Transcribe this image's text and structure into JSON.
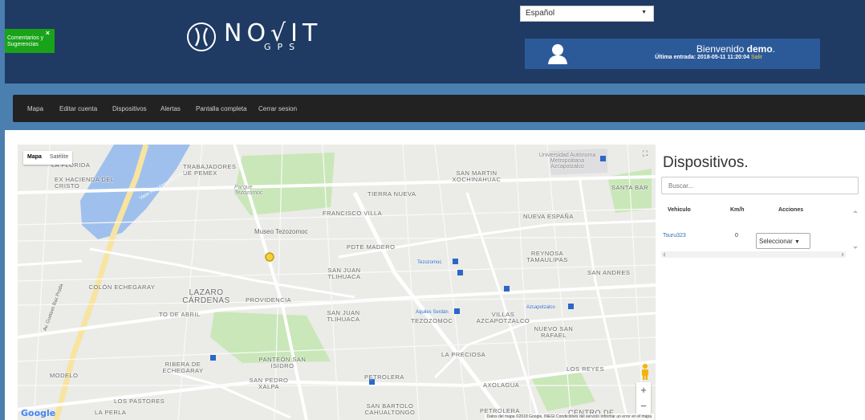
{
  "feedback": {
    "label": "Comentarios y Sugerencias",
    "close": "×"
  },
  "logo": {
    "brand": "NO√IT",
    "sub": "GPS"
  },
  "language": {
    "selected": "Español"
  },
  "welcome": {
    "greeting": "Bienvenido",
    "user": "demo",
    "period": ".",
    "last_login_label": "Última entrada: 2018-05-11 11:20:04",
    "logout": "Salir"
  },
  "nav": {
    "items": [
      "Mapa",
      "Editar cuenta",
      "Dispositivos",
      "Alertas",
      "Pantalla completa",
      "Cerrar sesion"
    ]
  },
  "map": {
    "type_map": "Mapa",
    "type_satellite": "Satélite",
    "zoom_in": "+",
    "zoom_out": "−",
    "attribution": "Datos del mapa ©2018 Google, INEGI   Condiciones del servicio   Informar un error en el mapa",
    "google": "Google",
    "labels": {
      "florida": "LA FLORIDA",
      "hacienda": "EX HACIENDA DEL CRISTO",
      "trabajadores": "TRABAJADORES DE PEMEX",
      "sanmartin": "SAN MARTIN XOCHINAHUAC",
      "universidad": "Universidad Autónoma Metropolitana Azcapotzalco",
      "santabar": "SANTA BAR",
      "parque": "Parque Tezozomoc",
      "tierranueva": "TIERRA NUEVA",
      "franciscovilla": "FRANCISCO VILLA",
      "nuevaespana": "NUEVA ESPAÑA",
      "museo": "Museo Tezozomoc",
      "pdte": "PDTE MADERO",
      "reynosa": "REYNOSA TAMAULIPAS",
      "sanjuan1": "SAN JUAN TLIHUACA",
      "sanandres": "SAN ANDRES",
      "colon": "COLÓN ECHEGARAY",
      "lazaro": "LAZARO CÁRDENAS",
      "providencia": "PROVIDENCIA",
      "deabril": "TO DE ABRIL",
      "sanjuan2": "SAN JUAN TLIHUACA",
      "tezozomoc": "TEZOZOMOC",
      "villas": "VILLAS AZCAPOTZALCO",
      "nuevo": "NUEVO SAN RAFAEL",
      "lapreciosa": "LA PRECIOSA",
      "panteon": "PANTEÓN SAN ISIDRO",
      "riberas": "RIBERA DE ECHEGARAY",
      "losreyes": "LOS REYES",
      "modelo": "MODELO",
      "sanpedro": "SAN PEDRO XALPA",
      "petrolera": "PETROLERA",
      "axolagua": "AXOLAGUA",
      "lospastores": "LOS PASTORES",
      "laperla": "LA PERLA",
      "sanbartolo": "SAN BARTOLO CAHUALTONGO",
      "petrolera2": "PETROLERA",
      "centrode": "CENTRO DE",
      "canal": "Vaso Regulador El Cristo",
      "gbaz": "Av. Gustavo Baz Prada",
      "tezozomocm": "Tezozomoc",
      "aquiles": "Aquiles Serdán",
      "azcapotzalcom": "Azcapotzalco"
    }
  },
  "devices": {
    "title": "Dispositivos.",
    "search_placeholder": "Buscar...",
    "columns": [
      "Vehiculo",
      "Km/h",
      "Acciones"
    ],
    "rows": [
      {
        "name": "Tsuru323",
        "kmh": "0",
        "action": "Seleccionar"
      }
    ],
    "select_caret": "▼"
  }
}
